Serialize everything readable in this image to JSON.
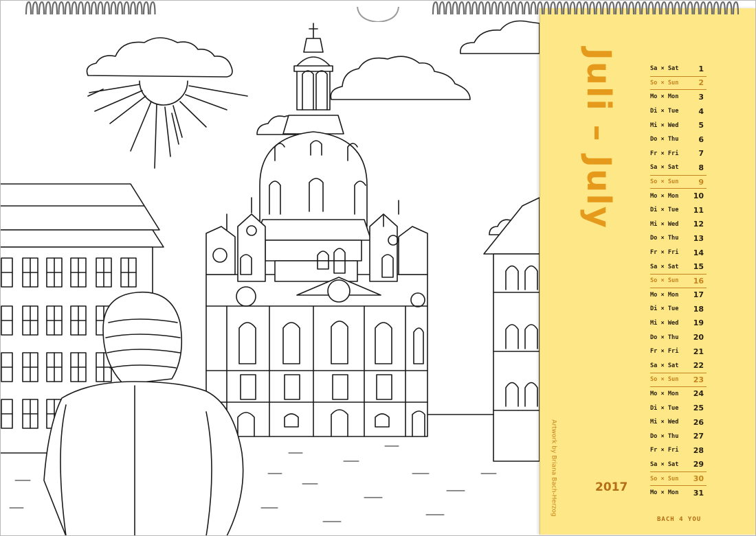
{
  "calendar": {
    "title": "Juli – July",
    "year": "2017",
    "credit": "Artwork by Briana Bach-Herzog",
    "brand": "BACH 4 YOU"
  },
  "days": [
    {
      "label": "Sa × Sat",
      "num": "1",
      "sunday": false
    },
    {
      "label": "So × Sun",
      "num": "2",
      "sunday": true
    },
    {
      "label": "Mo × Mon",
      "num": "3",
      "sunday": false
    },
    {
      "label": "Di × Tue",
      "num": "4",
      "sunday": false
    },
    {
      "label": "Mi × Wed",
      "num": "5",
      "sunday": false
    },
    {
      "label": "Do × Thu",
      "num": "6",
      "sunday": false
    },
    {
      "label": "Fr × Fri",
      "num": "7",
      "sunday": false
    },
    {
      "label": "Sa × Sat",
      "num": "8",
      "sunday": false
    },
    {
      "label": "So × Sun",
      "num": "9",
      "sunday": true
    },
    {
      "label": "Mo × Mon",
      "num": "10",
      "sunday": false
    },
    {
      "label": "Di × Tue",
      "num": "11",
      "sunday": false
    },
    {
      "label": "Mi × Wed",
      "num": "12",
      "sunday": false
    },
    {
      "label": "Do × Thu",
      "num": "13",
      "sunday": false
    },
    {
      "label": "Fr × Fri",
      "num": "14",
      "sunday": false
    },
    {
      "label": "Sa × Sat",
      "num": "15",
      "sunday": false
    },
    {
      "label": "So × Sun",
      "num": "16",
      "sunday": true
    },
    {
      "label": "Mo × Mon",
      "num": "17",
      "sunday": false
    },
    {
      "label": "Di × Tue",
      "num": "18",
      "sunday": false
    },
    {
      "label": "Mi × Wed",
      "num": "19",
      "sunday": false
    },
    {
      "label": "Do × Thu",
      "num": "20",
      "sunday": false
    },
    {
      "label": "Fr × Fri",
      "num": "21",
      "sunday": false
    },
    {
      "label": "Sa × Sat",
      "num": "22",
      "sunday": false
    },
    {
      "label": "So × Sun",
      "num": "23",
      "sunday": true
    },
    {
      "label": "Mo × Mon",
      "num": "24",
      "sunday": false
    },
    {
      "label": "Di × Tue",
      "num": "25",
      "sunday": false
    },
    {
      "label": "Mi × Wed",
      "num": "26",
      "sunday": false
    },
    {
      "label": "Do × Thu",
      "num": "27",
      "sunday": false
    },
    {
      "label": "Fr × Fri",
      "num": "28",
      "sunday": false
    },
    {
      "label": "Sa × Sat",
      "num": "29",
      "sunday": false
    },
    {
      "label": "So × Sun",
      "num": "30",
      "sunday": true
    },
    {
      "label": "Mo × Mon",
      "num": "31",
      "sunday": false
    }
  ],
  "colors": {
    "panel": "#fde786",
    "accent": "#e59a1c",
    "sunday": "#c4841e",
    "ink": "#2a2110"
  }
}
